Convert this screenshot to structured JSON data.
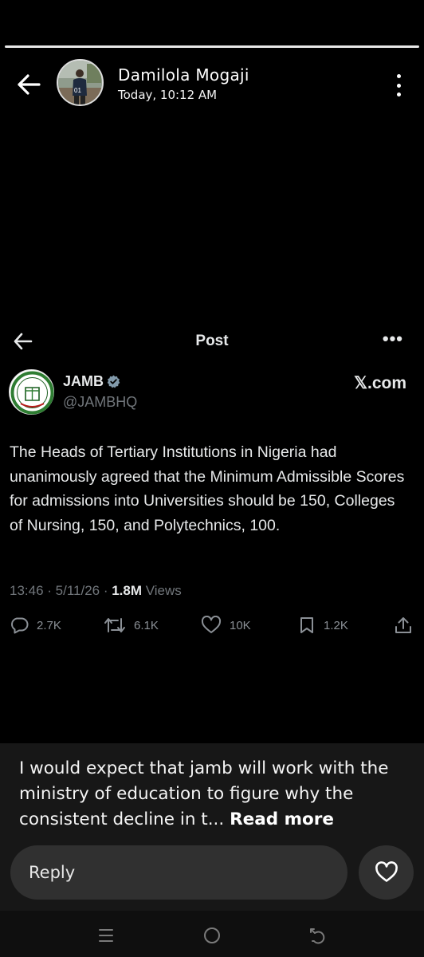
{
  "story": {
    "author_name": "Damilola Mogaji",
    "timestamp": "Today, 10:12 AM",
    "avatar_badge": "01"
  },
  "post_screen": {
    "title": "Post",
    "more_label": "•••",
    "brand": "𝕏.com"
  },
  "post": {
    "author_name": "JAMB",
    "author_handle": "@JAMBHQ",
    "text": "The Heads of Tertiary Institutions in Nigeria had unanimously agreed that the Minimum Admissible Scores for admissions into Universities should be 150, Colleges of Nursing, 150, and Polytechnics, 100.",
    "time_date": "13:46 · 5/11/26 · ",
    "views_count": "1.8M",
    "views_label": " Views",
    "replies": "2.7K",
    "reposts": "6.1K",
    "likes": "10K",
    "bookmarks": "1.2K"
  },
  "caption": {
    "text": "I would expect that jamb will work with the ministry of education to figure why the consistent decline in t... ",
    "read_more": "Read more"
  },
  "reply": {
    "label": "Reply"
  },
  "colors": {
    "background": "#000000",
    "panel": "#171717",
    "input": "#303030",
    "muted": "#71767b",
    "verified": "#829aab"
  }
}
